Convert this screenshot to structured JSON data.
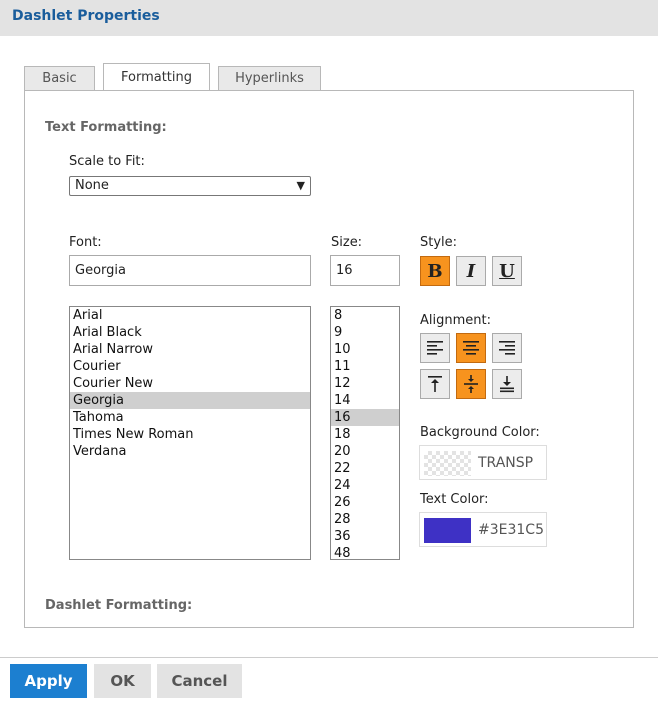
{
  "dialog": {
    "title": "Dashlet Properties"
  },
  "tabs": [
    {
      "label": "Basic"
    },
    {
      "label": "Formatting"
    },
    {
      "label": "Hyperlinks"
    }
  ],
  "text_formatting": {
    "heading": "Text Formatting:",
    "scale_label": "Scale to Fit:",
    "scale_value": "None",
    "font_label": "Font:",
    "font_value": "Georgia",
    "size_label": "Size:",
    "size_value": "16",
    "style_label": "Style:",
    "style_buttons": [
      {
        "glyph": "B",
        "icon": "bold-icon",
        "active": true
      },
      {
        "glyph": "I",
        "icon": "italic-icon",
        "active": false
      },
      {
        "glyph": "U",
        "icon": "underline-icon",
        "active": false
      }
    ],
    "fonts": [
      "Arial",
      "Arial Black",
      "Arial Narrow",
      "Courier",
      "Courier New",
      "Georgia",
      "Tahoma",
      "Times New Roman",
      "Verdana"
    ],
    "sizes": [
      "8",
      "9",
      "10",
      "11",
      "12",
      "14",
      "16",
      "18",
      "20",
      "22",
      "24",
      "26",
      "28",
      "36",
      "48"
    ],
    "alignment_label": "Alignment:",
    "alignment_buttons": [
      {
        "icon": "align-left-icon",
        "active": false
      },
      {
        "icon": "align-center-icon",
        "active": true
      },
      {
        "icon": "align-right-icon",
        "active": false
      },
      {
        "icon": "align-top-icon",
        "active": false
      },
      {
        "icon": "align-middle-icon",
        "active": true
      },
      {
        "icon": "align-bottom-icon",
        "active": false
      }
    ],
    "background_color_label": "Background Color:",
    "background_color_value": "TRANSP",
    "text_color_label": "Text Color:",
    "text_color_value": "#3E31C5"
  },
  "dashlet_formatting": {
    "heading": "Dashlet Formatting:"
  },
  "footer": {
    "apply": "Apply",
    "ok": "OK",
    "cancel": "Cancel"
  },
  "colors": {
    "accent": "#1c7fd0",
    "active_button": "#f7931e",
    "title": "#1a5d9c",
    "text_color_swatch": "#3E31C5"
  }
}
